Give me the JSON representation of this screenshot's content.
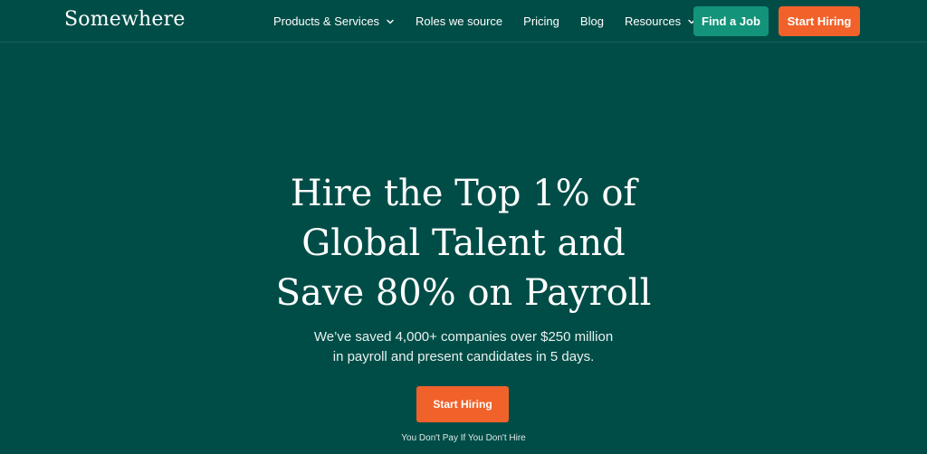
{
  "brand": {
    "logo_text": "Somewhere"
  },
  "nav": {
    "items": [
      {
        "label": "Products & Services",
        "has_dropdown": true
      },
      {
        "label": "Roles we source",
        "has_dropdown": false
      },
      {
        "label": "Pricing",
        "has_dropdown": false
      },
      {
        "label": "Blog",
        "has_dropdown": false
      },
      {
        "label": "Resources",
        "has_dropdown": true
      }
    ],
    "find_job_label": "Find a Job",
    "start_hiring_label": "Start Hiring"
  },
  "hero": {
    "headline_lines": [
      "Hire the Top 1% of",
      "Global Talent and",
      "Save 80% on Payroll"
    ],
    "subhead_lines": [
      "We’ve saved 4,000+ companies over $250 million",
      "in payroll and present candidates in 5 days."
    ],
    "cta_label": "Start Hiring",
    "note": "You Don't Pay If You Don't Hire"
  },
  "colors": {
    "background": "#004d47",
    "accent_orange": "#f0622a",
    "accent_teal": "#13937a"
  },
  "icons": {
    "dropdown": "chevron-down-icon"
  }
}
